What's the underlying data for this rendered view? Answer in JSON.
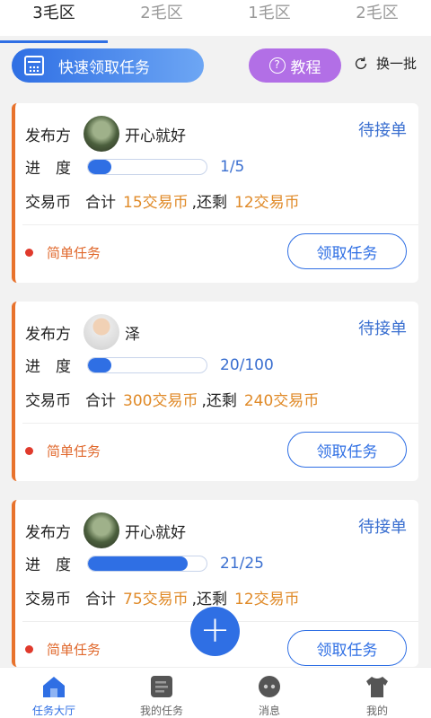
{
  "tabs": [
    {
      "label": "3毛区",
      "active": true
    },
    {
      "label": "2毛区",
      "active": false
    },
    {
      "label": "1毛区",
      "active": false
    },
    {
      "label": "2毛区",
      "active": false
    }
  ],
  "actions": {
    "quick_label": "快速领取任务",
    "tutorial_label": "教程",
    "refresh_label": "换一批"
  },
  "labels": {
    "publisher": "发布方",
    "progress": "进　度",
    "currency": "交易币",
    "total": "合计",
    "remaining_prefix": ",还剩"
  },
  "cards": [
    {
      "publisher": "开心就好",
      "status": "待接单",
      "progress_text": "1/5",
      "progress": 0.2,
      "total": "15交易币",
      "remaining": "12交易币",
      "tag": "简单任务",
      "button": "领取任务",
      "avatar": "nature"
    },
    {
      "publisher": "泽",
      "status": "待接单",
      "progress_text": "20/100",
      "progress": 0.2,
      "total": "300交易币",
      "remaining": "240交易币",
      "tag": "简单任务",
      "button": "领取任务",
      "avatar": "person"
    },
    {
      "publisher": "开心就好",
      "status": "待接单",
      "progress_text": "21/25",
      "progress": 0.84,
      "total": "75交易币",
      "remaining": "12交易币",
      "tag": "简单任务",
      "button": "领取任务",
      "avatar": "nature"
    }
  ],
  "fab_label": "+",
  "bottom_nav": [
    {
      "label": "任务大厅",
      "active": true,
      "icon": "home-icon"
    },
    {
      "label": "我的任务",
      "active": false,
      "icon": "task-list-icon"
    },
    {
      "label": "消息",
      "active": false,
      "icon": "message-icon"
    },
    {
      "label": "我的",
      "active": false,
      "icon": "shirt-icon"
    }
  ],
  "colors": {
    "accent": "#2f6fe4",
    "orange": "#e08a28",
    "purple": "#b26fe6"
  }
}
